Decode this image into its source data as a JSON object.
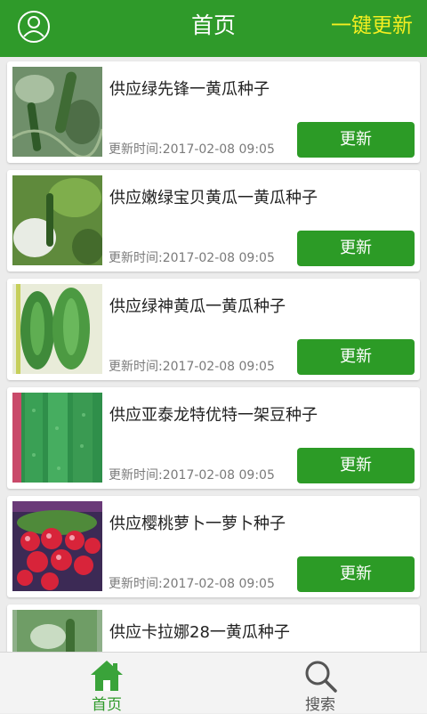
{
  "header": {
    "title": "首页",
    "update_all_label": "一键更新",
    "bg_color": "#2f9a2a",
    "accent_color": "#f5ef21"
  },
  "items": [
    {
      "name": "供应绿先锋一黄瓜种子",
      "time": "更新时间:2017-02-08 09:05",
      "button": "更新",
      "thumb": "cucumber-vine-photo"
    },
    {
      "name": "供应嫩绿宝贝黄瓜一黄瓜种子",
      "time": "更新时间:2017-02-08 09:05",
      "button": "更新",
      "thumb": "cucumber-leaves-photo"
    },
    {
      "name": "供应绿神黄瓜一黄瓜种子",
      "time": "更新时间:2017-02-08 09:05",
      "button": "更新",
      "thumb": "green-cucumbers-photo"
    },
    {
      "name": "供应亚泰龙特优特一架豆种子",
      "time": "更新时间:2017-02-08 09:05",
      "button": "更新",
      "thumb": "green-beans-photo"
    },
    {
      "name": "供应樱桃萝卜一萝卜种子",
      "time": "更新时间:2017-02-08 09:05",
      "button": "更新",
      "thumb": "cherry-radish-photo"
    },
    {
      "name": "供应卡拉娜28一黄瓜种子",
      "time": "",
      "button": "",
      "thumb": "cucumber-photo"
    }
  ],
  "tabbar": {
    "home_label": "首页",
    "search_label": "搜索",
    "home_icon": "home-icon",
    "search_icon": "search-icon"
  }
}
